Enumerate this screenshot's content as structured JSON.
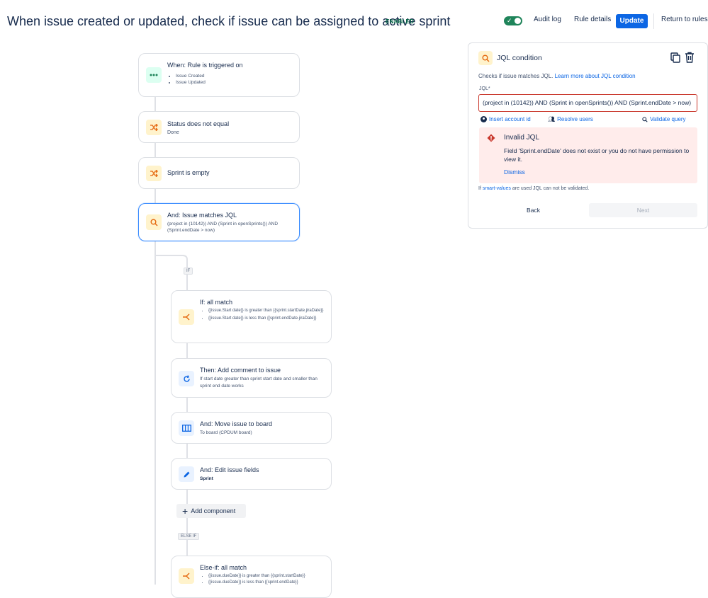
{
  "header": {
    "title": "When issue created or updated, check if issue can be assigned to active sprint",
    "status_badge": "ENABLED",
    "audit_log": "Audit log",
    "rule_details": "Rule details",
    "update": "Update",
    "return_to_rules": "Return to rules"
  },
  "flow": {
    "trigger": {
      "title": "When: Rule is triggered on",
      "items": [
        "Issue Created",
        "Issue Updated"
      ]
    },
    "cond1": {
      "title": "Status does not equal",
      "sub": "Done"
    },
    "cond2": {
      "title": "Sprint is empty"
    },
    "cond3": {
      "title": "And: Issue matches JQL",
      "sub": "(project in (10142)) AND (Sprint in openSprints()) AND (Sprint.endDate > now)"
    },
    "if_tag": "IF",
    "if_block": {
      "title": "If: all match",
      "items": [
        "{{issue.Start date}} is greater than {{sprint.startDate.jiraDate}}",
        "{{issue.Start date}} is less than {{sprint.endDate.jiraDate}}"
      ]
    },
    "then_comment": {
      "title": "Then: Add comment to issue",
      "sub": "If start date greater than sprint start date and smaller than sprint end date works"
    },
    "move_board": {
      "title": "And: Move issue to board",
      "sub": "To board (CPDUM board)"
    },
    "edit_fields": {
      "title": "And: Edit issue fields",
      "sub": "Sprint"
    },
    "add_component": "Add component",
    "else_if_tag": "ELSE IF",
    "else_if_block": {
      "title": "Else-if: all match",
      "items": [
        "{{issue.dueDate}} is greater than {{sprint.startDate}}",
        "{{issue.dueDate}} is less than {{sprint.endDate}}"
      ]
    }
  },
  "panel": {
    "title": "JQL condition",
    "desc": "Checks if issue matches JQL.",
    "learn_more": "Learn more about JQL condition",
    "jql_label": "JQL*",
    "jql_value": "(project in (10142)) AND (Sprint in openSprints()) AND (Sprint.endDate > now)",
    "insert_account": "Insert account id",
    "resolve_users": "Resolve users",
    "validate_query": "Validate query",
    "error_title": "Invalid JQL",
    "error_msg": "Field 'Sprint.endDate' does not exist or you do not have permission to view it.",
    "dismiss": "Dismiss",
    "note_prefix": "If",
    "note_link": "smart-values",
    "note_suffix": "are used JQL can not be validated.",
    "back": "Back",
    "next": "Next"
  },
  "colors": {
    "primary": "#0c66e4",
    "error": "#c9372c",
    "enabled": "#1f845a"
  }
}
